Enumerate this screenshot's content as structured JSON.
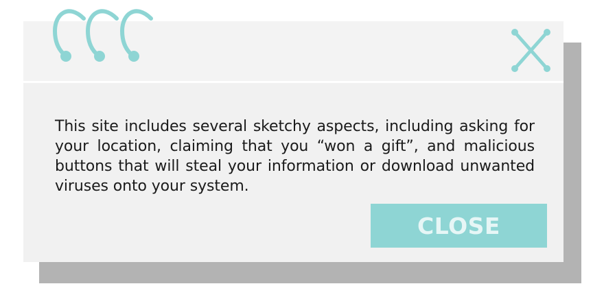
{
  "dialog": {
    "message": "This site includes several sketchy aspects, including asking for your location, claiming that you “won a gift”, and malicious buttons that will steal your information or download unwanted viruses onto your system.",
    "close_button_label": "CLOSE",
    "close_icon": "close-x-icon",
    "ring_icon": "binder-ring-icon",
    "ring_count": 3
  },
  "colors": {
    "accent": "#8ed5d4",
    "button_text": "#e6f6f6",
    "dialog_bg": "#f2f2f2",
    "shadow": "#b3b3b3",
    "text": "#1a1a1a"
  }
}
